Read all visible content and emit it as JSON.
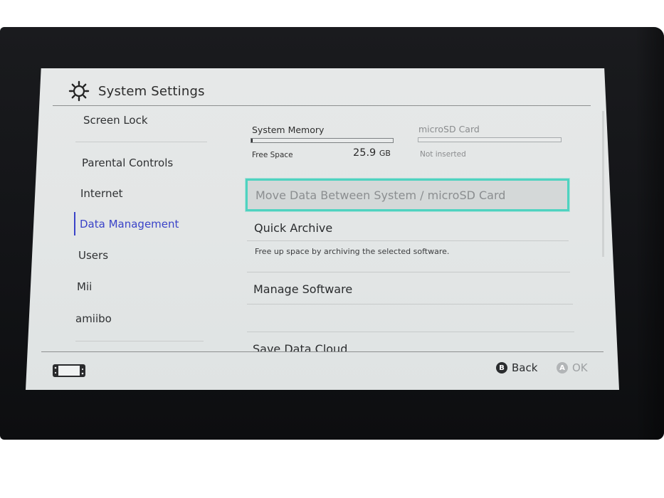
{
  "header": {
    "title": "System Settings",
    "icon": "gear-icon"
  },
  "sidebar": {
    "items": [
      {
        "label": "Screen Lock"
      },
      {
        "label": "Parental Controls"
      },
      {
        "label": "Internet"
      },
      {
        "label": "Data Management",
        "active": true
      },
      {
        "label": "Users"
      },
      {
        "label": "Mii"
      },
      {
        "label": "amiibo"
      }
    ]
  },
  "storage": {
    "system": {
      "label": "System Memory",
      "free_label": "Free Space",
      "free_value": "25.9",
      "unit": "GB",
      "used_fraction": 0.01
    },
    "sd": {
      "label": "microSD Card",
      "status": "Not inserted"
    }
  },
  "main": {
    "items": [
      {
        "title": "Move Data Between System / microSD Card",
        "selected": true
      },
      {
        "title": "Quick Archive",
        "description": "Free up space by archiving the selected software."
      },
      {
        "title": "Manage Software"
      },
      {
        "title": "Save Data Cloud"
      }
    ]
  },
  "footer": {
    "back": {
      "glyph": "B",
      "label": "Back"
    },
    "ok": {
      "glyph": "A",
      "label": "OK"
    }
  },
  "colors": {
    "accent": "#3a43c8",
    "selection": "#4fd3c0"
  }
}
